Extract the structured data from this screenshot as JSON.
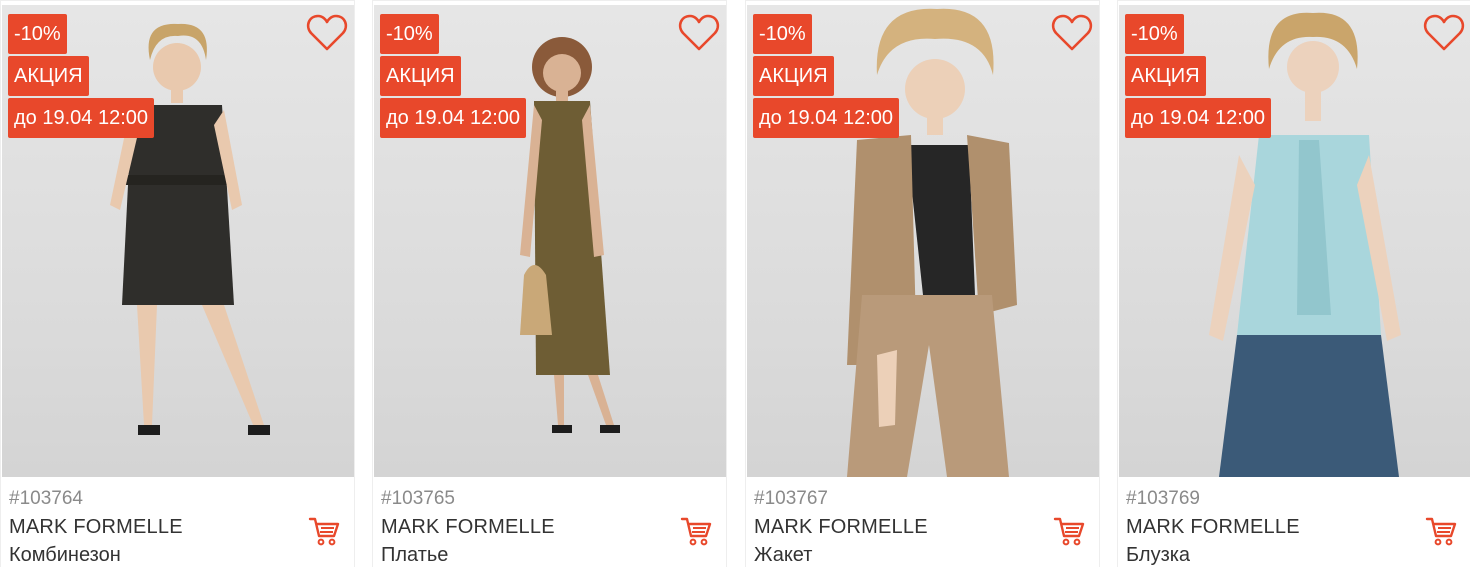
{
  "accent_color": "#e8482b",
  "products": [
    {
      "discount": "-10%",
      "promo": "АКЦИЯ",
      "deadline": "до 19.04 12:00",
      "sku": "#103764",
      "brand": "MARK FORMELLE",
      "name": "Комбинезон",
      "outfit_color": "#2f2e2b",
      "photo_alt": "model wearing dark jumpsuit"
    },
    {
      "discount": "-10%",
      "promo": "АКЦИЯ",
      "deadline": "до 19.04 12:00",
      "sku": "#103765",
      "brand": "MARK FORMELLE",
      "name": "Платье",
      "outfit_color": "#6e5d34",
      "photo_alt": "model wearing olive slip dress"
    },
    {
      "discount": "-10%",
      "promo": "АКЦИЯ",
      "deadline": "до 19.04 12:00",
      "sku": "#103767",
      "brand": "MARK FORMELLE",
      "name": "Жакет",
      "outfit_color": "#b0906d",
      "photo_alt": "model wearing beige jacket"
    },
    {
      "discount": "-10%",
      "promo": "АКЦИЯ",
      "deadline": "до 19.04 12:00",
      "sku": "#103769",
      "brand": "MARK FORMELLE",
      "name": "Блузка",
      "outfit_color": "#a9d6dc",
      "photo_alt": "model wearing light blue blouse"
    }
  ],
  "icons": {
    "favorite": "heart-icon",
    "cart": "cart-icon"
  }
}
